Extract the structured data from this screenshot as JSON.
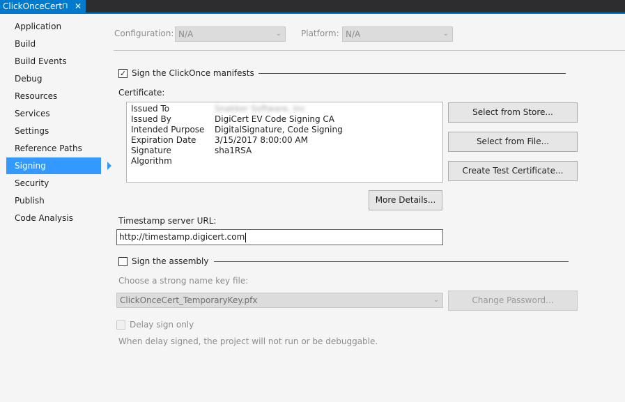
{
  "tab": {
    "title": "ClickOnceCert",
    "pin_glyph": "⊓",
    "close_glyph": "✕"
  },
  "nav": {
    "items": [
      "Application",
      "Build",
      "Build Events",
      "Debug",
      "Resources",
      "Services",
      "Settings",
      "Reference Paths",
      "Signing",
      "Security",
      "Publish",
      "Code Analysis"
    ],
    "active": "Signing"
  },
  "config": {
    "label": "Configuration:",
    "value": "N/A"
  },
  "platform": {
    "label": "Platform:",
    "value": "N/A"
  },
  "sign_manifests": {
    "label": "Sign the ClickOnce manifests",
    "checked": true
  },
  "certificate": {
    "label": "Certificate:",
    "rows": [
      {
        "key": "Issued To",
        "value": "Snakker Software, Inc"
      },
      {
        "key": "Issued By",
        "value": "DigiCert EV Code Signing CA"
      },
      {
        "key": "Intended Purpose",
        "value": "DigitalSignature, Code Signing"
      },
      {
        "key": "Expiration Date",
        "value": "3/15/2017 8:00:00 AM"
      },
      {
        "key": "Signature Algorithm",
        "value": "sha1RSA"
      }
    ]
  },
  "buttons": {
    "select_store": "Select from Store...",
    "select_file": "Select from File...",
    "create_test": "Create Test Certificate...",
    "more_details": "More Details...",
    "change_password": "Change Password..."
  },
  "timestamp": {
    "label": "Timestamp server URL:",
    "value": "http://timestamp.digicert.com"
  },
  "sign_assembly": {
    "label": "Sign the assembly",
    "checked": false
  },
  "strong_name": {
    "label": "Choose a strong name key file:",
    "value": "ClickOnceCert_TemporaryKey.pfx"
  },
  "delay_sign": {
    "label": "Delay sign only",
    "note": "When delay signed, the project will not run or be debuggable."
  },
  "check_glyph": "✓",
  "chevron_glyph": "⌄",
  "colors": {
    "accent": "#007acc",
    "nav_active": "#3399ff",
    "titlebar": "#2d2d30"
  }
}
